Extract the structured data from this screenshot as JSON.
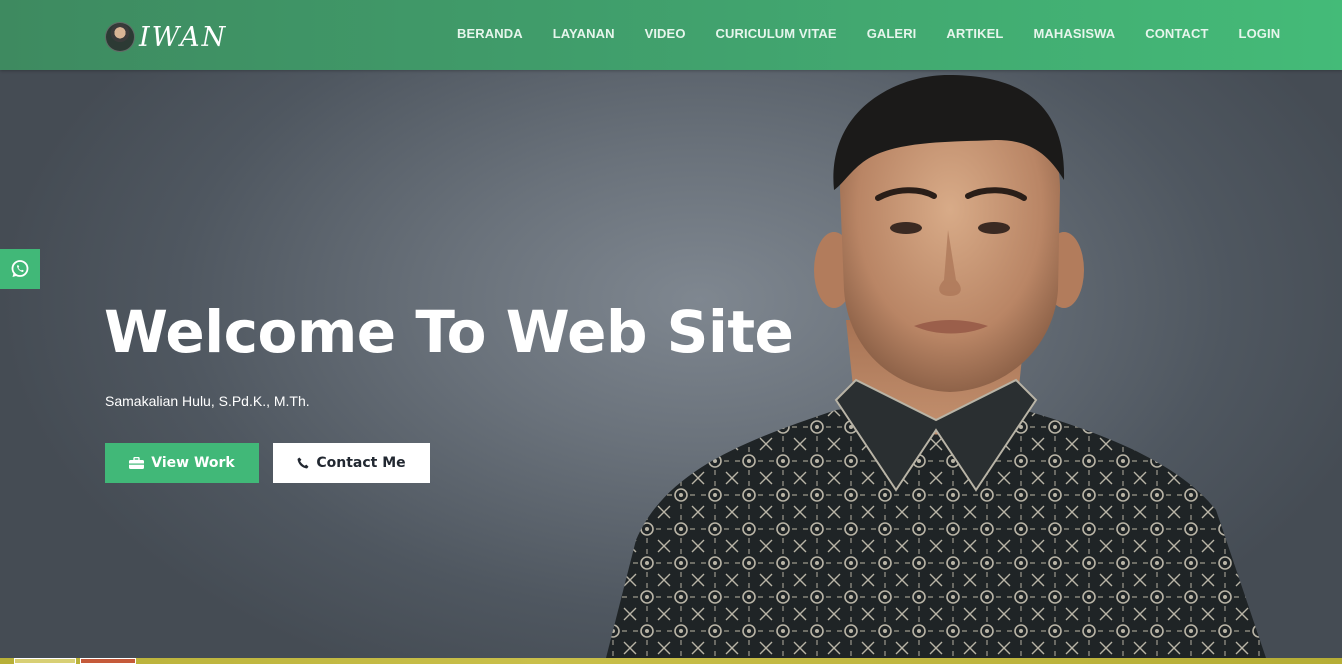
{
  "brand": {
    "name": "IWAN",
    "avatar_icon": "profile-photo"
  },
  "nav": {
    "items": [
      "BERANDA",
      "LAYANAN",
      "VIDEO",
      "CURICULUM VITAE",
      "GALERI",
      "ARTIKEL",
      "MAHASISWA",
      "CONTACT",
      "LOGIN"
    ]
  },
  "hero": {
    "title": "Welcome To Web Site",
    "subtitle": "Samakalian Hulu, S.Pd.K., M.Th.",
    "primary_button": {
      "label": "View Work",
      "icon": "briefcase-icon"
    },
    "secondary_button": {
      "label": "Contact Me",
      "icon": "phone-icon"
    }
  },
  "side_tab": {
    "icon": "whatsapp-icon"
  },
  "colors": {
    "accent_green": "#41b878",
    "nav_gradient_start": "#3e8a60",
    "nav_gradient_end": "#44bb78",
    "hero_bg": "#5f6770"
  }
}
